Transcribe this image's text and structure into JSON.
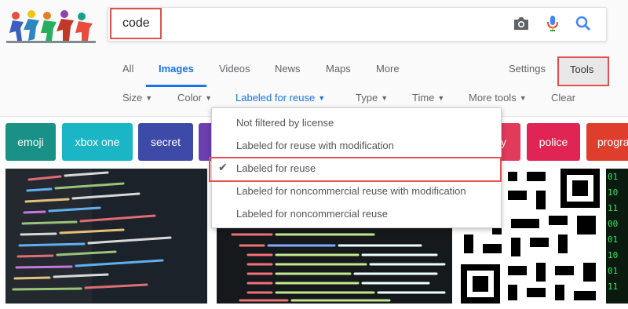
{
  "search": {
    "query": "code"
  },
  "tabs": [
    {
      "label": "All"
    },
    {
      "label": "Images"
    },
    {
      "label": "Videos"
    },
    {
      "label": "News"
    },
    {
      "label": "Maps"
    },
    {
      "label": "More"
    }
  ],
  "settings_label": "Settings",
  "tools_label": "Tools",
  "filters": [
    {
      "label": "Size"
    },
    {
      "label": "Color"
    },
    {
      "label": "Labeled for reuse"
    },
    {
      "label": "Type"
    },
    {
      "label": "Time"
    },
    {
      "label": "More tools"
    },
    {
      "label": "Clear"
    }
  ],
  "dropdown": {
    "items": [
      {
        "label": "Not filtered by license",
        "checked": false
      },
      {
        "label": "Labeled for reuse with modification",
        "checked": false
      },
      {
        "label": "Labeled for reuse",
        "checked": true
      },
      {
        "label": "Labeled for noncommercial reuse with modification",
        "checked": false
      },
      {
        "label": "Labeled for noncommercial reuse",
        "checked": false
      }
    ]
  },
  "chips": [
    {
      "label": "emoji",
      "color": "#1a9186"
    },
    {
      "label": "xbox one",
      "color": "#1bb6c6"
    },
    {
      "label": "secret",
      "color": "#3e4aa8"
    },
    {
      "label": "y",
      "color": "#e13a5b"
    },
    {
      "label": "police",
      "color": "#e02453"
    },
    {
      "label": "progra",
      "color": "#e03e2d"
    }
  ],
  "colors": {
    "accent": "#1a73e8",
    "highlight": "#e0504f"
  }
}
